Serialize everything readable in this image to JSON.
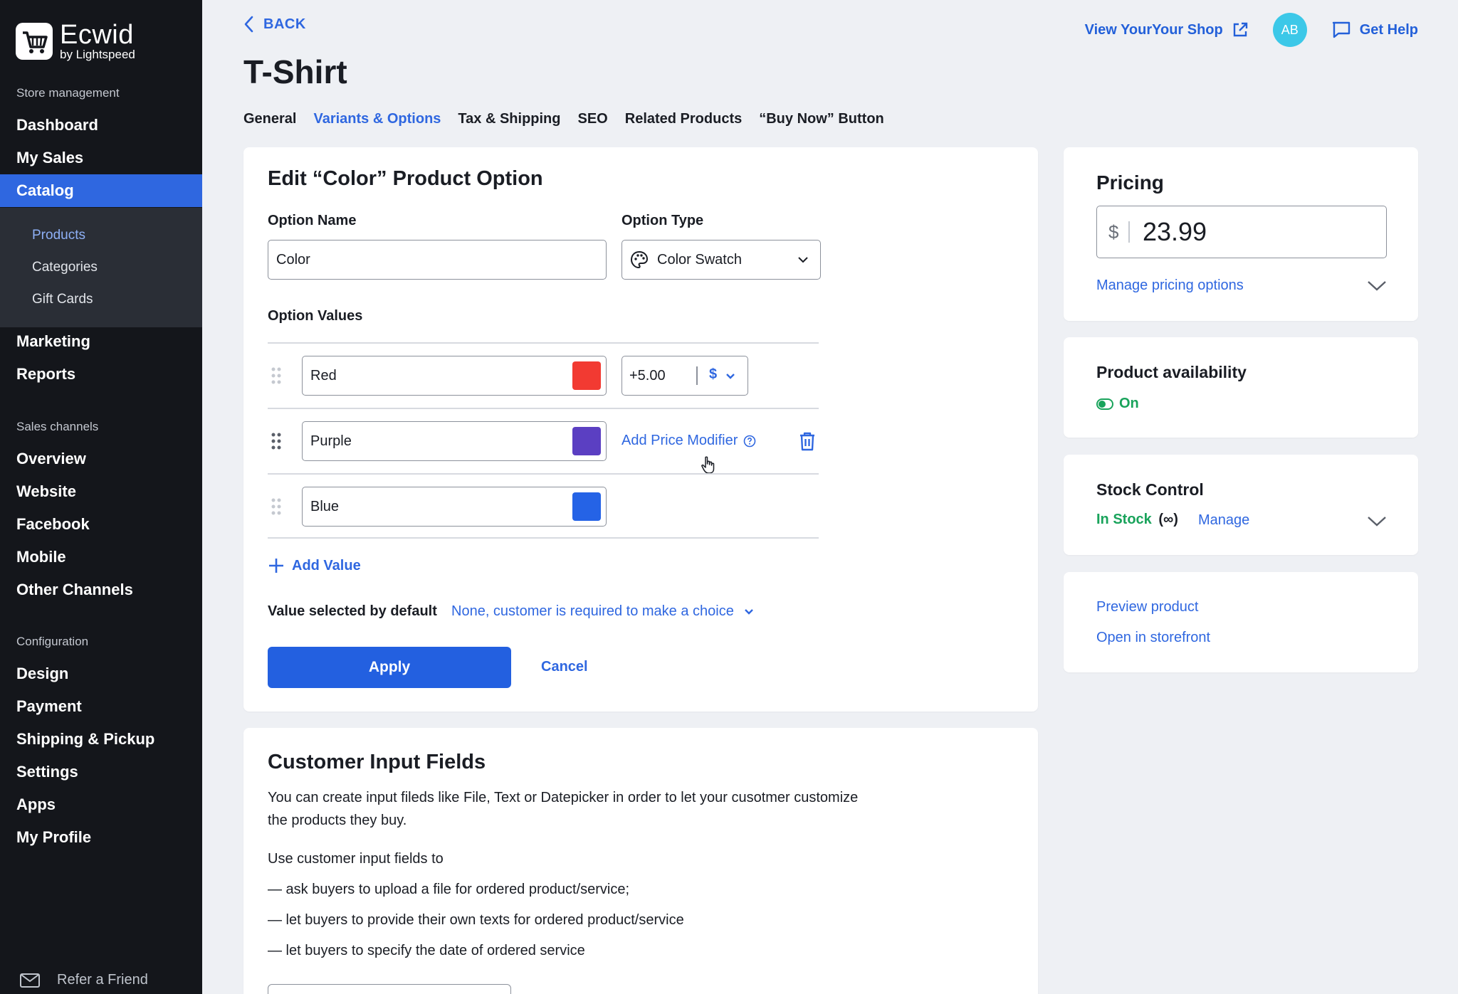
{
  "brand": {
    "name": "Ecwid",
    "sub": "by Lightspeed"
  },
  "sidebar": {
    "sections": [
      {
        "title": "Store management"
      },
      {
        "title": "Sales channels"
      },
      {
        "title": "Configuration"
      }
    ],
    "store": [
      "Dashboard",
      "My Sales",
      "Catalog"
    ],
    "catalog_sub": [
      "Products",
      "Categories",
      "Gift Cards"
    ],
    "store2": [
      "Marketing",
      "Reports"
    ],
    "channels": [
      "Overview",
      "Website",
      "Facebook",
      "Mobile",
      "Other Channels"
    ],
    "config": [
      "Design",
      "Payment",
      "Shipping & Pickup",
      "Settings",
      "Apps",
      "My Profile"
    ],
    "refer": "Refer a Friend"
  },
  "header": {
    "back": "BACK",
    "title": "T-Shirt",
    "view_shop": "View YourYour Shop",
    "avatar": "AB",
    "help": "Get Help"
  },
  "tabs": [
    "General",
    "Variants & Options",
    "Tax & Shipping",
    "SEO",
    "Related Products",
    "“Buy Now” Button"
  ],
  "option_editor": {
    "heading": "Edit “Color” Product Option",
    "name_label": "Option Name",
    "name_value": "Color",
    "type_label": "Option Type",
    "type_value": "Color Swatch",
    "values_label": "Option Values",
    "values": [
      {
        "name": "Red",
        "color": "#f23a32"
      },
      {
        "name": "Purple",
        "color": "#5b3fc2"
      },
      {
        "name": "Blue",
        "color": "#2563e6"
      }
    ],
    "price_modifier": "+5.00",
    "currency": "$",
    "add_price_modifier": "Add Price Modifier",
    "add_value": "Add Value",
    "default_label": "Value selected by default",
    "default_value": "None, customer is required to make a choice",
    "apply": "Apply",
    "cancel": "Cancel"
  },
  "customer_input": {
    "heading": "Customer Input Fields",
    "intro_1": "You can create input fileds like File, Text or Datepicker in order to let your cusotmer customize",
    "intro_2": "the products they buy.",
    "use_label": "Use customer input fields to",
    "bullets": [
      "— ask buyers to upload a file for ordered product/service;",
      "— let buyers to provide their own texts for ordered product/service",
      "— let buyers to specify the date of ordered service"
    ]
  },
  "pricing": {
    "heading": "Pricing",
    "currency": "$",
    "value": "23.99",
    "manage": "Manage pricing options"
  },
  "availability": {
    "heading": "Product availability",
    "status": "On"
  },
  "stock": {
    "heading": "Stock Control",
    "status": "In Stock",
    "infinite": "(∞)",
    "manage": "Manage"
  },
  "links": {
    "preview": "Preview product",
    "storefront": "Open in storefront"
  },
  "colors": {
    "accent": "#2f67e0",
    "sidebar": "#14161b",
    "green": "#19a35b"
  }
}
